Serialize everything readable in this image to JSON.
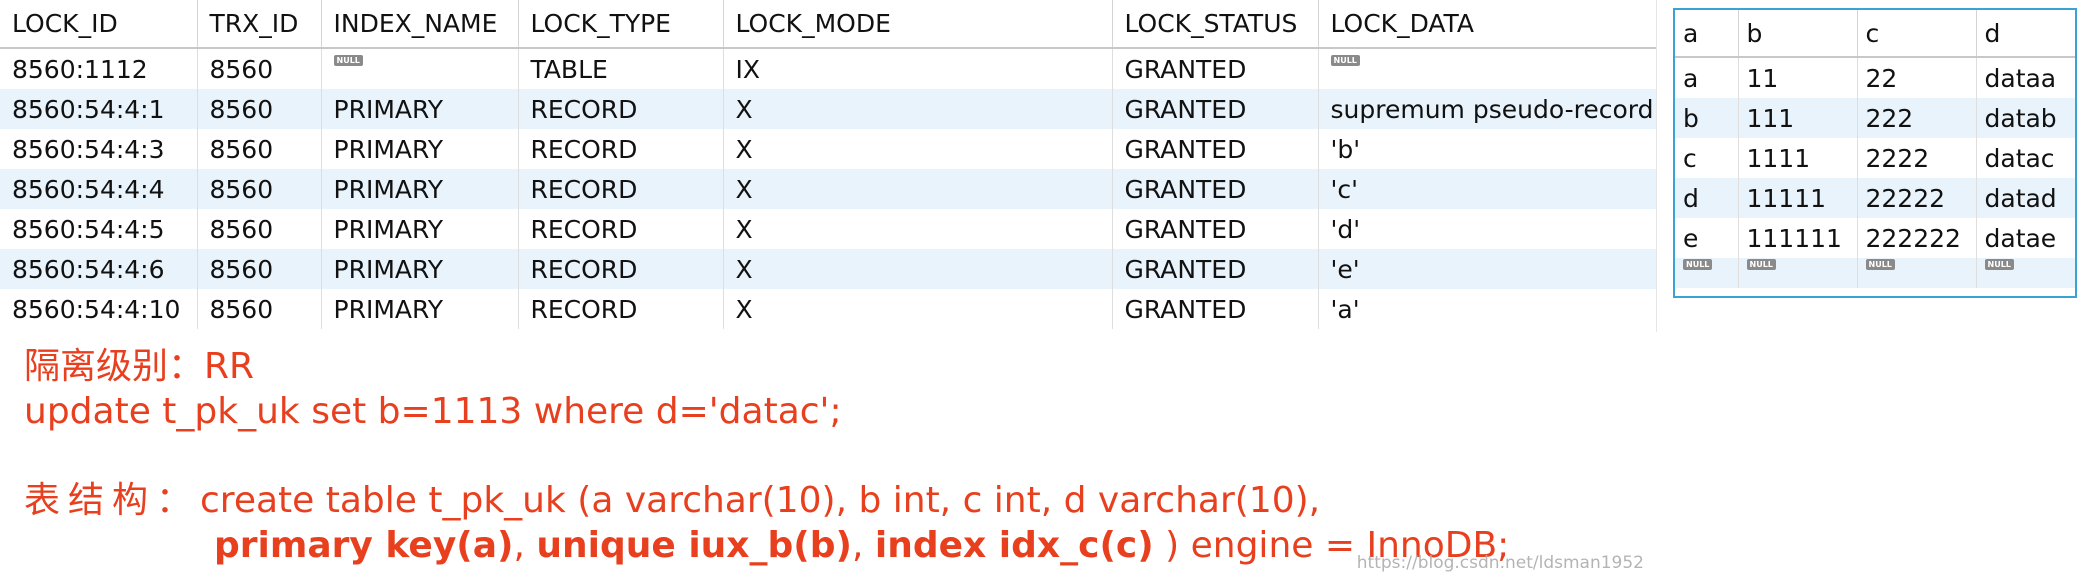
{
  "locks_grid": {
    "columns": [
      "LOCK_ID",
      "TRX_ID",
      "INDEX_NAME",
      "LOCK_TYPE",
      "LOCK_MODE",
      "LOCK_STATUS",
      "LOCK_DATA"
    ],
    "rows": [
      [
        "8560:1112",
        "8560",
        null,
        "TABLE",
        "IX",
        "GRANTED",
        null
      ],
      [
        "8560:54:4:1",
        "8560",
        "PRIMARY",
        "RECORD",
        "X",
        "GRANTED",
        "supremum pseudo-record"
      ],
      [
        "8560:54:4:3",
        "8560",
        "PRIMARY",
        "RECORD",
        "X",
        "GRANTED",
        "'b'"
      ],
      [
        "8560:54:4:4",
        "8560",
        "PRIMARY",
        "RECORD",
        "X",
        "GRANTED",
        "'c'"
      ],
      [
        "8560:54:4:5",
        "8560",
        "PRIMARY",
        "RECORD",
        "X",
        "GRANTED",
        "'d'"
      ],
      [
        "8560:54:4:6",
        "8560",
        "PRIMARY",
        "RECORD",
        "X",
        "GRANTED",
        "'e'"
      ],
      [
        "8560:54:4:10",
        "8560",
        "PRIMARY",
        "RECORD",
        "X",
        "GRANTED",
        "'a'"
      ]
    ]
  },
  "data_grid": {
    "columns": [
      "a",
      "b",
      "c",
      "d"
    ],
    "rows": [
      [
        "a",
        "11",
        "22",
        "dataa"
      ],
      [
        "b",
        "111",
        "222",
        "datab"
      ],
      [
        "c",
        "1111",
        "2222",
        "datac"
      ],
      [
        "d",
        "11111",
        "22222",
        "datad"
      ],
      [
        "e",
        "111111",
        "222222",
        "datae"
      ]
    ],
    "new_row": [
      null,
      null,
      null,
      null
    ]
  },
  "null_label": "NULL",
  "notes": {
    "isolation": "隔离级别：RR",
    "sql": "update t_pk_uk set b=1113 where d='datac';",
    "schema_label": "表结构：",
    "schema_line1": "create table t_pk_uk (a varchar(10), b int, c int, d varchar(10),",
    "schema_line2": {
      "pk": "primary key(a)",
      "sep1": ", ",
      "uk": "unique iux_b(b)",
      "sep2": ", ",
      "idx": "index idx_c(c)",
      "tail": " ) engine = InnoDB;"
    }
  },
  "watermark": "https://blog.csdn.net/ldsman1952",
  "colors": {
    "annotation": "#e8401e",
    "row_alt": "#e9f3fb",
    "selection_border": "#3aa3d6",
    "null_badge": "#8a8a8a"
  }
}
